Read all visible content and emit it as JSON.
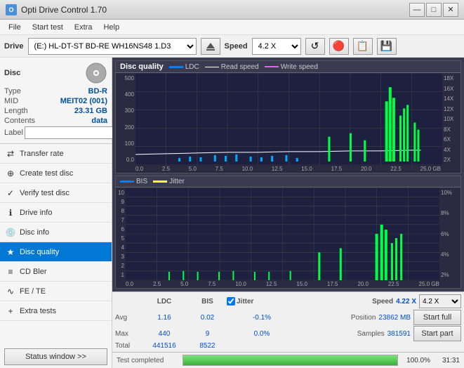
{
  "titlebar": {
    "title": "Opti Drive Control 1.70",
    "icon_text": "O",
    "minimize_label": "—",
    "maximize_label": "□",
    "close_label": "✕"
  },
  "menubar": {
    "items": [
      "File",
      "Start test",
      "Extra",
      "Help"
    ]
  },
  "drivebar": {
    "drive_label": "Drive",
    "drive_value": "(E:)  HL-DT-ST BD-RE  WH16NS48 1.D3",
    "speed_label": "Speed",
    "speed_value": "4.2 X"
  },
  "disc": {
    "title": "Disc",
    "type_label": "Type",
    "type_value": "BD-R",
    "mid_label": "MID",
    "mid_value": "MEIT02 (001)",
    "length_label": "Length",
    "length_value": "23.31 GB",
    "contents_label": "Contents",
    "contents_value": "data",
    "label_label": "Label"
  },
  "nav": {
    "items": [
      {
        "id": "transfer-rate",
        "label": "Transfer rate",
        "icon": "⇄"
      },
      {
        "id": "create-test-disc",
        "label": "Create test disc",
        "icon": "⊕"
      },
      {
        "id": "verify-test-disc",
        "label": "Verify test disc",
        "icon": "✓"
      },
      {
        "id": "drive-info",
        "label": "Drive info",
        "icon": "ℹ"
      },
      {
        "id": "disc-info",
        "label": "Disc info",
        "icon": "💿"
      },
      {
        "id": "disc-quality",
        "label": "Disc quality",
        "icon": "★",
        "active": true
      },
      {
        "id": "cd-bler",
        "label": "CD Bler",
        "icon": "≡"
      },
      {
        "id": "fe-te",
        "label": "FE / TE",
        "icon": "∿"
      },
      {
        "id": "extra-tests",
        "label": "Extra tests",
        "icon": "+"
      }
    ],
    "status_btn": "Status window >>"
  },
  "chart_top": {
    "title": "Disc quality",
    "legend": [
      {
        "id": "ldc",
        "label": "LDC",
        "color": "#00aaff"
      },
      {
        "id": "read-speed",
        "label": "Read speed",
        "color": "#ffffff"
      },
      {
        "id": "write-speed",
        "label": "Write speed",
        "color": "#ff44ff"
      }
    ],
    "y_labels_left": [
      "500",
      "400",
      "300",
      "200",
      "100",
      "0.0"
    ],
    "y_labels_right": [
      "18X",
      "16X",
      "14X",
      "12X",
      "10X",
      "8X",
      "6X",
      "4X",
      "2X"
    ],
    "x_labels": [
      "0.0",
      "2.5",
      "5.0",
      "7.5",
      "10.0",
      "12.5",
      "15.0",
      "17.5",
      "20.0",
      "22.5",
      "25.0 GB"
    ]
  },
  "chart_bottom": {
    "legend": [
      {
        "id": "bis",
        "label": "BIS",
        "color": "#00aaff"
      },
      {
        "id": "jitter",
        "label": "Jitter",
        "color": "#ffff00"
      }
    ],
    "y_labels_left": [
      "10",
      "9",
      "8",
      "7",
      "6",
      "5",
      "4",
      "3",
      "2",
      "1"
    ],
    "y_labels_right": [
      "10%",
      "8%",
      "6%",
      "4%",
      "2%"
    ],
    "x_labels": [
      "0.0",
      "2.5",
      "5.0",
      "7.5",
      "10.0",
      "12.5",
      "15.0",
      "17.5",
      "20.0",
      "22.5",
      "25.0 GB"
    ]
  },
  "stats": {
    "col_ldc": "LDC",
    "col_bis": "BIS",
    "col_jitter": "Jitter",
    "col_speed": "Speed",
    "avg_label": "Avg",
    "avg_ldc": "1.16",
    "avg_bis": "0.02",
    "avg_jitter": "-0.1%",
    "max_label": "Max",
    "max_ldc": "440",
    "max_bis": "9",
    "max_jitter": "0.0%",
    "total_label": "Total",
    "total_ldc": "441516",
    "total_bis": "8522",
    "speed_value": "4.22 X",
    "speed_select": "4.2 X",
    "position_label": "Position",
    "position_value": "23862 MB",
    "samples_label": "Samples",
    "samples_value": "381591",
    "start_full_label": "Start full",
    "start_part_label": "Start part",
    "jitter_checkbox": true,
    "jitter_label": "Jitter"
  },
  "progressbar": {
    "status_text": "Test completed",
    "percentage": "100.0%",
    "progress_value": 100,
    "time": "31:31"
  }
}
